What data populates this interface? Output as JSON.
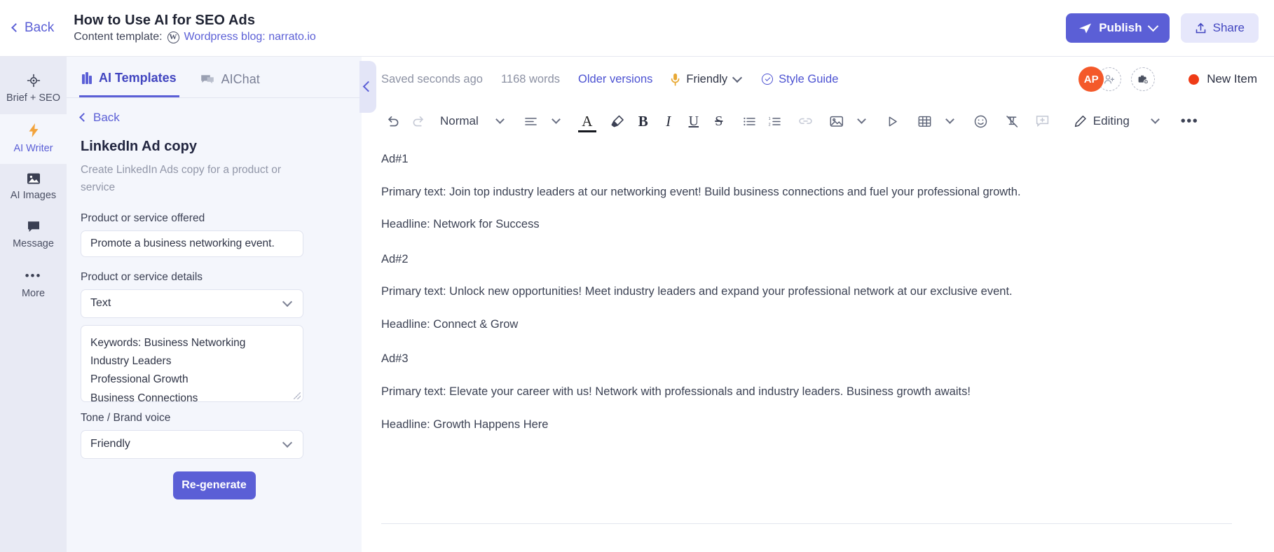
{
  "topbar": {
    "back_label": "Back",
    "doc_title": "How to Use AI for SEO Ads",
    "template_prefix": "Content template:",
    "template_name": "Wordpress blog: narrato.io",
    "wp_glyph": "W",
    "publish_label": "Publish",
    "share_label": "Share",
    "publish_icon": "send-icon",
    "share_icon": "upload-icon",
    "accent": "#5b5fd6",
    "share_bg": "#e6e7fb"
  },
  "rail": {
    "items": [
      {
        "label": "Brief + SEO",
        "icon": "target-icon",
        "glyph": "⌖",
        "active": false
      },
      {
        "label": "AI Writer",
        "icon": "lightning-bolt-icon",
        "glyph": "⚡",
        "active": true
      },
      {
        "label": "AI Images",
        "icon": "image-icon",
        "glyph": "⬛",
        "active": false
      },
      {
        "label": "Message",
        "icon": "chat-bubble-icon",
        "glyph": "⬛",
        "active": false
      },
      {
        "label": "More",
        "icon": "ellipsis-icon",
        "glyph": "•••",
        "active": false
      }
    ]
  },
  "panel": {
    "tabs": [
      {
        "label": "AI Templates",
        "icon": "templates-icon",
        "active": true
      },
      {
        "label": "AIChat",
        "icon": "chat-icon",
        "active": false
      }
    ],
    "back_label": "Back",
    "title": "LinkedIn Ad copy",
    "description": "Create LinkedIn Ads copy for a product or service",
    "fields": [
      {
        "label": "Product or service offered",
        "type": "input",
        "value": "Promote a business networking event."
      },
      {
        "label": "Product or service details",
        "type": "select",
        "value": "Text"
      }
    ],
    "details_textarea": {
      "lines": [
        "Keywords: Business Networking",
        "Industry Leaders",
        "Professional Growth",
        "Business Connections"
      ]
    },
    "tone_field": {
      "label": "Tone / Brand voice",
      "value": "Friendly"
    },
    "regenerate_label": "Re-generate",
    "collapse_icon": "chevron-left-icon"
  },
  "editor": {
    "status": {
      "saved_text": "Saved seconds ago",
      "word_count": "1168 words",
      "older_versions": "Older versions",
      "tone": "Friendly",
      "style_guide": "Style Guide",
      "avatar_initials": "AP",
      "avatar_color": "#f4592a",
      "add_person_icon": "add-person-icon",
      "add_item_icon": "add-briefcase-icon",
      "status_dot_color": "#ef3b16",
      "status_label": "New Item"
    },
    "toolbar": {
      "undo": "undo-icon",
      "redo": "redo-icon",
      "paragraph_style": "Normal",
      "align": "align-left-icon",
      "text_color": "A",
      "highlight": "highlighter-icon",
      "bold": "B",
      "italic": "I",
      "underline": "U",
      "strikethrough": "S",
      "bullet_list": "bullet-list-icon",
      "numbered_list": "numbered-list-icon",
      "link": "link-icon",
      "image": "image-icon",
      "media": "play-icon",
      "table": "table-icon",
      "emoji": "emoji-icon",
      "clear_format": "clear-format-icon",
      "comment": "add-comment-icon",
      "mode_label": "Editing",
      "more": "ellipsis-icon"
    },
    "document": {
      "blocks": [
        {
          "heading": "Ad#1",
          "primary": "Primary text: Join top industry leaders at our networking event! Build business connections and fuel your professional growth.",
          "headline": "Headline: Network for Success"
        },
        {
          "heading": "Ad#2",
          "primary": "Primary text: Unlock new opportunities! Meet industry leaders and expand your professional network at our exclusive event.",
          "headline": "Headline: Connect & Grow"
        },
        {
          "heading": "Ad#3",
          "primary": "Primary text: Elevate your career with us! Network with professionals and industry leaders. Business growth awaits!",
          "headline": "Headline: Growth Happens Here"
        }
      ]
    }
  }
}
